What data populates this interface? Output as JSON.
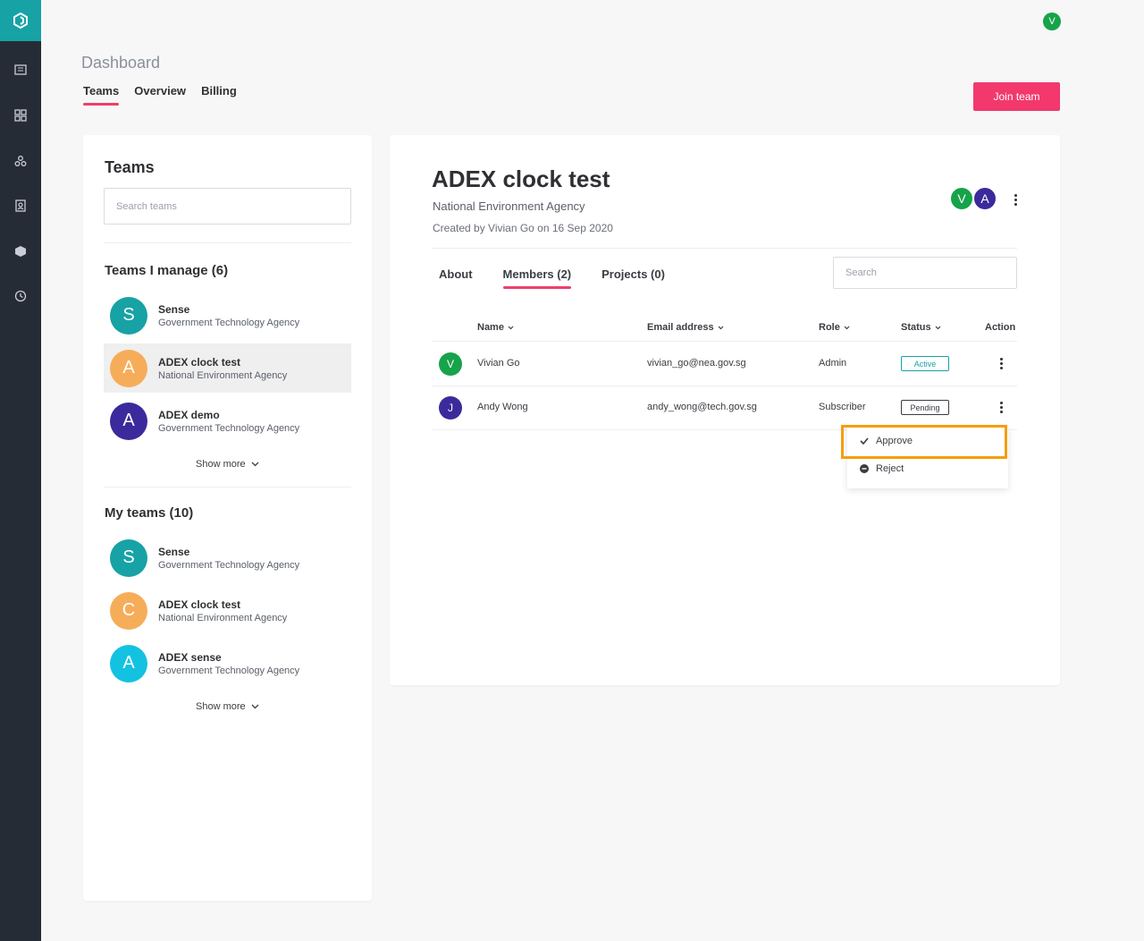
{
  "top_avatar": "V",
  "page_title": "Dashboard",
  "top_tabs": [
    {
      "label": "Teams"
    },
    {
      "label": "Overview"
    },
    {
      "label": "Billing"
    }
  ],
  "join_button": "Join team",
  "left": {
    "title": "Teams",
    "search_placeholder": "Search teams",
    "manage_title": "Teams I manage (6)",
    "manage_items": [
      {
        "initial": "S",
        "name": "Sense",
        "org": "Government Technology Agency",
        "color": "#17a2a5"
      },
      {
        "initial": "A",
        "name": "ADEX clock test",
        "org": "National Environment Agency",
        "color": "#f6ad5a"
      },
      {
        "initial": "A",
        "name": "ADEX demo",
        "org": "Government Technology Agency",
        "color": "#3b2a9b"
      }
    ],
    "show_more_1": "Show more",
    "my_title": "My teams (10)",
    "my_items": [
      {
        "initial": "S",
        "name": "Sense",
        "org": "Government Technology Agency",
        "color": "#17a2a5"
      },
      {
        "initial": "C",
        "name": "ADEX clock test",
        "org": "National Environment Agency",
        "color": "#f6ad5a"
      },
      {
        "initial": "A",
        "name": "ADEX sense",
        "org": "Government Technology Agency",
        "color": "#13c2e0"
      }
    ],
    "show_more_2": "Show more"
  },
  "detail": {
    "title": "ADEX clock test",
    "org": "National Environment Agency",
    "created": "Created by Vivian Go on 16 Sep 2020",
    "avatars": [
      {
        "initial": "V",
        "color": "#16a34a"
      },
      {
        "initial": "A",
        "color": "#3b2a9b"
      }
    ],
    "tabs": [
      {
        "label": "About"
      },
      {
        "label": "Members (2)"
      },
      {
        "label": "Projects (0)"
      }
    ],
    "search_placeholder": "Search",
    "columns": {
      "name": "Name",
      "email": "Email address",
      "role": "Role",
      "status": "Status",
      "action": "Action"
    },
    "rows": [
      {
        "initial": "V",
        "color": "#16a34a",
        "name": "Vivian Go",
        "email": "vivian_go@nea.gov.sg",
        "role": "Admin",
        "status": "Active"
      },
      {
        "initial": "J",
        "color": "#3b2a9b",
        "name": "Andy Wong",
        "email": "andy_wong@tech.gov.sg",
        "role": "Subscriber",
        "status": "Pending"
      }
    ],
    "menu": {
      "approve": "Approve",
      "reject": "Reject"
    }
  }
}
